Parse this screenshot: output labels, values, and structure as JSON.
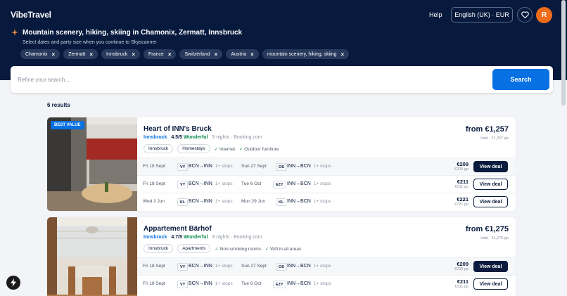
{
  "header": {
    "logo": "VibeTravel",
    "help": "Help",
    "language_currency": "English (UK) · EUR",
    "avatar_initial": "R"
  },
  "trip": {
    "title": "Mountain scenery, hiking, skiing in Chamonix, Zermatt, Innsbruck",
    "subtitle": "Select dates and party size when you continue to Skyscanner",
    "chips": [
      "Chamonix",
      "Zermatt",
      "Innsbruck",
      "France",
      "Switzerland",
      "Austria",
      "mountain scenery, hiking, skiing"
    ]
  },
  "search": {
    "placeholder": "Refine your search...",
    "button": "Search"
  },
  "results": {
    "count": "6 results",
    "cards": [
      {
        "badge": "BEST VALUE",
        "name": "Heart of INN's Bruck",
        "city": "Innsbruck",
        "rating": "4.5/5",
        "rating_word": "Wonderful",
        "nights_source": "9 nights · Booking.com",
        "tags": [
          "Innsbruck",
          "Homestays"
        ],
        "amenities": [
          "Internet",
          "Outdoor furniture"
        ],
        "price_from": "from €1,257",
        "price_total": "total · €1,257 pp",
        "flights": [
          {
            "out_date": "Fri 18 Sept",
            "out_air": "VY",
            "out_route": "BCN→INN",
            "out_stops": "1+ stops",
            "ret_date": "Sun 27 Sept",
            "ret_air": "OS",
            "ret_route": "INN→BCN",
            "ret_stops": "1+ stops",
            "price": "€209",
            "pp": "€209 pp",
            "deal": "View deal",
            "primary": true
          },
          {
            "out_date": "Fri 18 Sept",
            "out_air": "VY",
            "out_route": "BCN→INN",
            "out_stops": "1+ stops",
            "ret_date": "Tue 6 Oct",
            "ret_air": "EZY",
            "ret_route": "INN→BCN",
            "ret_stops": "1+ stops",
            "price": "€211",
            "pp": "€211 pp",
            "deal": "View deal",
            "primary": false
          },
          {
            "out_date": "Wed 3 Jun",
            "out_air": "KL",
            "out_route": "BCN→INN",
            "out_stops": "1+ stops",
            "ret_date": "Mon 29 Jun",
            "ret_air": "KL",
            "ret_route": "INN→BCN",
            "ret_stops": "1+ stops",
            "price": "€221",
            "pp": "€221 pp",
            "deal": "View deal",
            "primary": false
          }
        ]
      },
      {
        "badge": "",
        "name": "Appartement Bärhof",
        "city": "Innsbruck",
        "rating": "4.7/5",
        "rating_word": "Wonderful",
        "nights_source": "9 nights · Booking.com",
        "tags": [
          "Innsbruck",
          "Apartments"
        ],
        "amenities": [
          "Non-smoking rooms",
          "Wifi in all areas"
        ],
        "price_from": "from €1,275",
        "price_total": "total · €1,275 pp",
        "flights": [
          {
            "out_date": "Fri 18 Sept",
            "out_air": "VY",
            "out_route": "BCN→INN",
            "out_stops": "1+ stops",
            "ret_date": "Sun 27 Sept",
            "ret_air": "OS",
            "ret_route": "INN→BCN",
            "ret_stops": "1+ stops",
            "price": "€209",
            "pp": "€209 pp",
            "deal": "View deal",
            "primary": true
          },
          {
            "out_date": "Fri 18 Sept",
            "out_air": "VY",
            "out_route": "BCN→INN",
            "out_stops": "1+ stops",
            "ret_date": "Tue 6 Oct",
            "ret_air": "EZY",
            "ret_route": "INN→BCN",
            "ret_stops": "1+ stops",
            "price": "€211",
            "pp": "€211 pp",
            "deal": "View deal",
            "primary": false
          }
        ]
      }
    ]
  },
  "colors": {
    "header_bg": "#071a3d",
    "accent_blue": "#0770e3",
    "rating_green": "#0b8a4e",
    "avatar_orange": "#ef6c1a"
  },
  "icons": [
    "sparkle-icon",
    "heart-icon",
    "close-icon",
    "check-icon",
    "bolt-icon"
  ]
}
